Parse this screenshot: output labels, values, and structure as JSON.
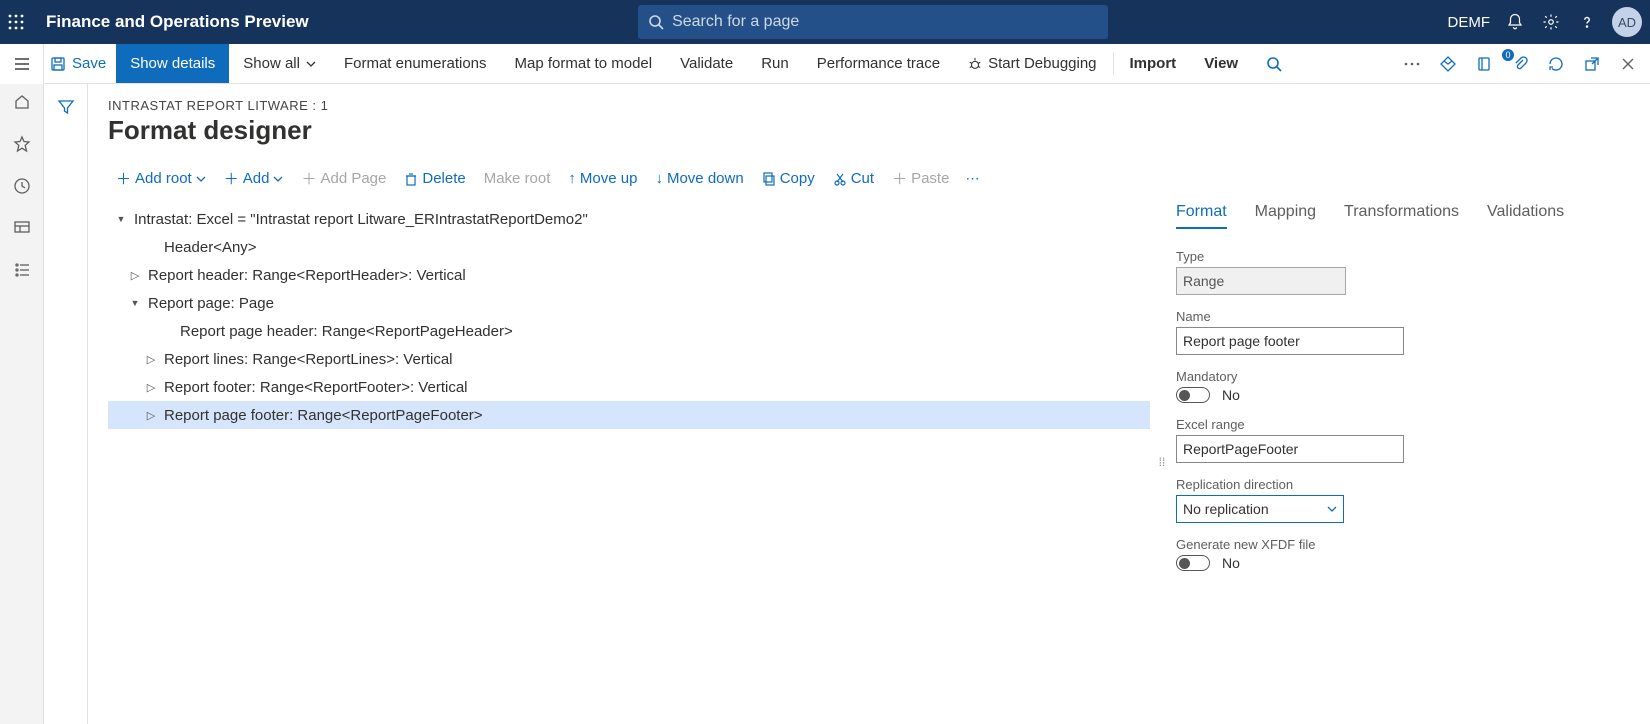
{
  "topbar": {
    "title": "Finance and Operations Preview",
    "search_placeholder": "Search for a page",
    "company": "DEMF",
    "avatar": "AD"
  },
  "cmdbar": {
    "save": "Save",
    "show_details": "Show details",
    "show_all": "Show all",
    "format_enum": "Format enumerations",
    "map_format": "Map format to model",
    "validate": "Validate",
    "run": "Run",
    "perf_trace": "Performance trace",
    "start_debug": "Start Debugging",
    "import": "Import",
    "view": "View",
    "badge": "0"
  },
  "page": {
    "breadcrumb": "INTRASTAT REPORT LITWARE : 1",
    "title": "Format designer"
  },
  "toolbar2": {
    "add_root": "Add root",
    "add": "Add",
    "add_page": "Add Page",
    "delete": "Delete",
    "make_root": "Make root",
    "move_up": "Move up",
    "move_down": "Move down",
    "copy": "Copy",
    "cut": "Cut",
    "paste": "Paste"
  },
  "tree": [
    {
      "indent": 0,
      "tw": "▾",
      "label": "Intrastat: Excel = \"Intrastat report Litware_ERIntrastatReportDemo2\"",
      "sel": false
    },
    {
      "indent": 2,
      "tw": "",
      "label": "Header<Any>",
      "sel": false
    },
    {
      "indent": 1,
      "tw": "▸",
      "label": "Report header: Range<ReportHeader>: Vertical",
      "sel": false
    },
    {
      "indent": 1,
      "tw": "▾",
      "label": "Report page: Page",
      "sel": false
    },
    {
      "indent": 3,
      "tw": "",
      "label": "Report page header: Range<ReportPageHeader>",
      "sel": false
    },
    {
      "indent": 2,
      "tw": "▸",
      "label": "Report lines: Range<ReportLines>: Vertical",
      "sel": false
    },
    {
      "indent": 2,
      "tw": "▸",
      "label": "Report footer: Range<ReportFooter>: Vertical",
      "sel": false
    },
    {
      "indent": 2,
      "tw": "▸",
      "label": "Report page footer: Range<ReportPageFooter>",
      "sel": true
    }
  ],
  "tabs": {
    "format": "Format",
    "mapping": "Mapping",
    "transformations": "Transformations",
    "validations": "Validations"
  },
  "props": {
    "type_label": "Type",
    "type_value": "Range",
    "name_label": "Name",
    "name_value": "Report page footer",
    "mandatory_label": "Mandatory",
    "mandatory_value": "No",
    "excel_range_label": "Excel range",
    "excel_range_value": "ReportPageFooter",
    "repl_label": "Replication direction",
    "repl_value": "No replication",
    "xfdf_label": "Generate new XFDF file",
    "xfdf_value": "No"
  }
}
